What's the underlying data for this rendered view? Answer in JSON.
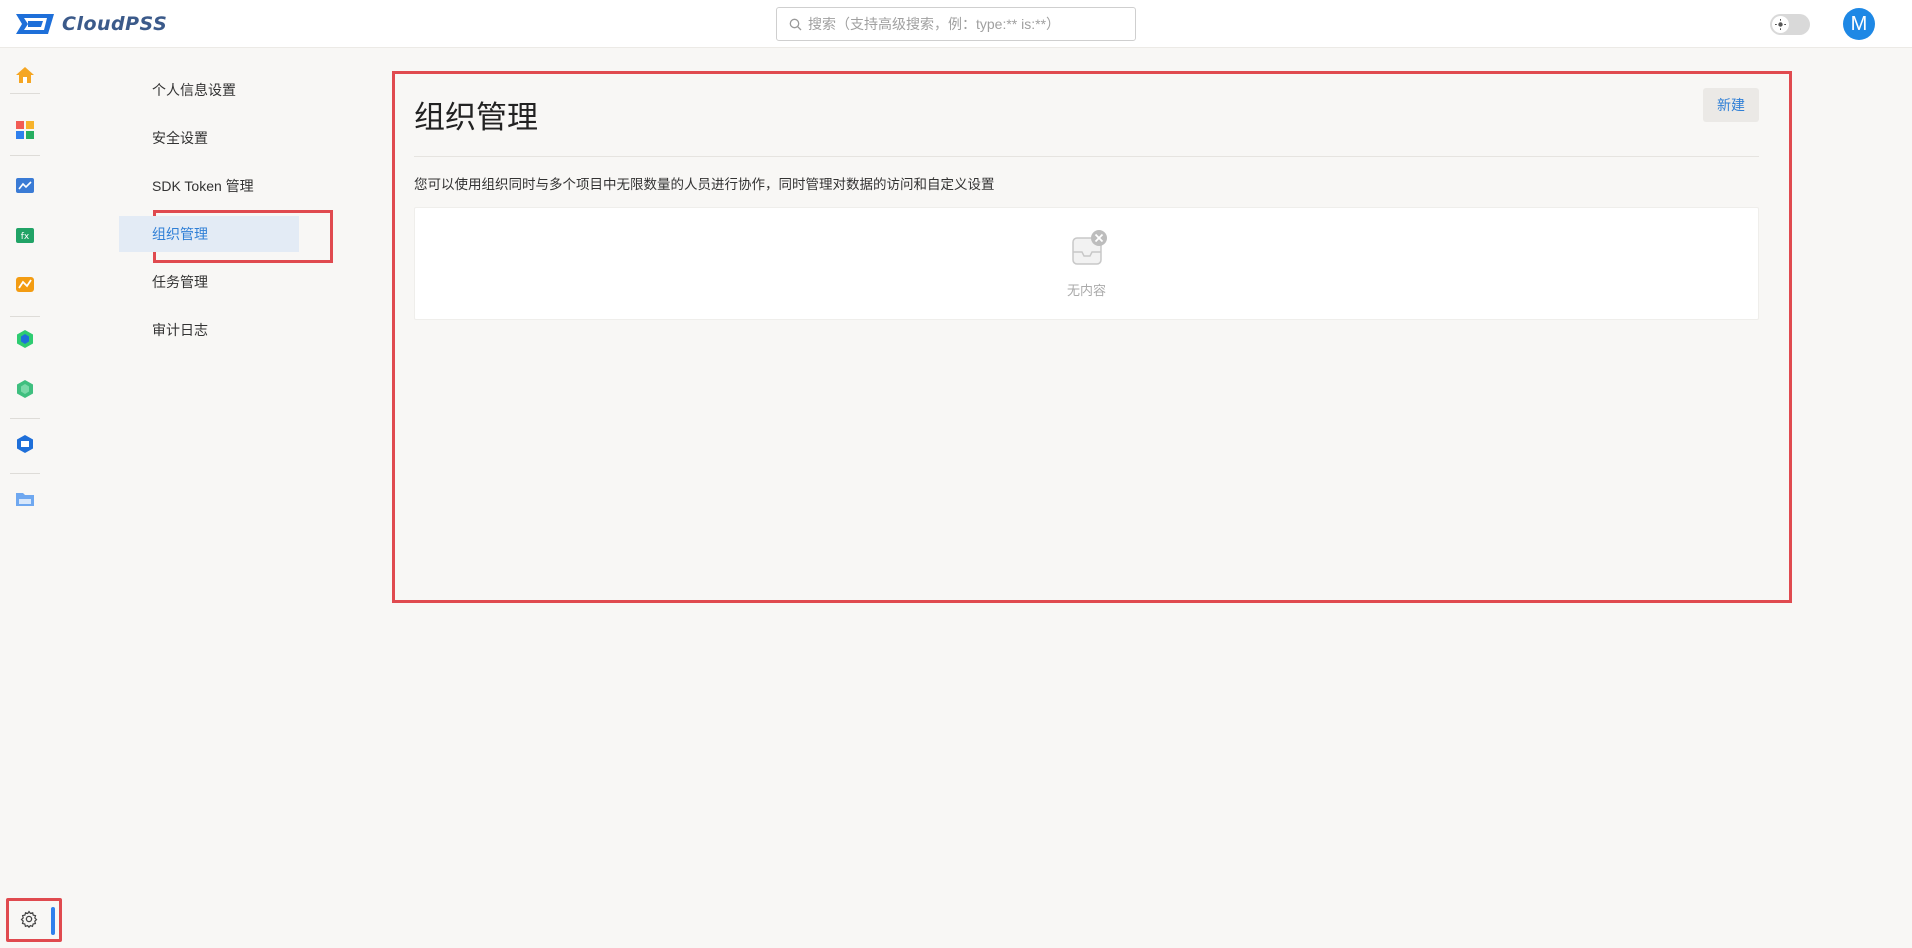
{
  "app": {
    "logo_text": "CloudPSS"
  },
  "search": {
    "placeholder": "搜索（支持高级搜索，例：type:** is:**）"
  },
  "user": {
    "avatar_initial": "M"
  },
  "rail": {
    "icons": [
      "home-icon",
      "apps-icon",
      "dashboard-icon",
      "function-icon",
      "chart-icon",
      "hex-app-icon",
      "hex-app-2-icon",
      "model-icon",
      "folder-icon"
    ],
    "settings_icon": "gear-icon"
  },
  "submenu": {
    "items": [
      {
        "label": "个人信息设置",
        "active": false
      },
      {
        "label": "安全设置",
        "active": false
      },
      {
        "label": "SDK Token 管理",
        "active": false
      },
      {
        "label": "组织管理",
        "active": true
      },
      {
        "label": "任务管理",
        "active": false
      },
      {
        "label": "审计日志",
        "active": false
      }
    ]
  },
  "main": {
    "title": "组织管理",
    "new_button_label": "新建",
    "description": "您可以使用组织同时与多个项目中无限数量的人员进行协作，同时管理对数据的访问和自定义设置",
    "empty_text": "无内容"
  },
  "colors": {
    "accent": "#2f7fd6",
    "highlight_border": "#e04a4f",
    "avatar": "#1e88e5"
  }
}
